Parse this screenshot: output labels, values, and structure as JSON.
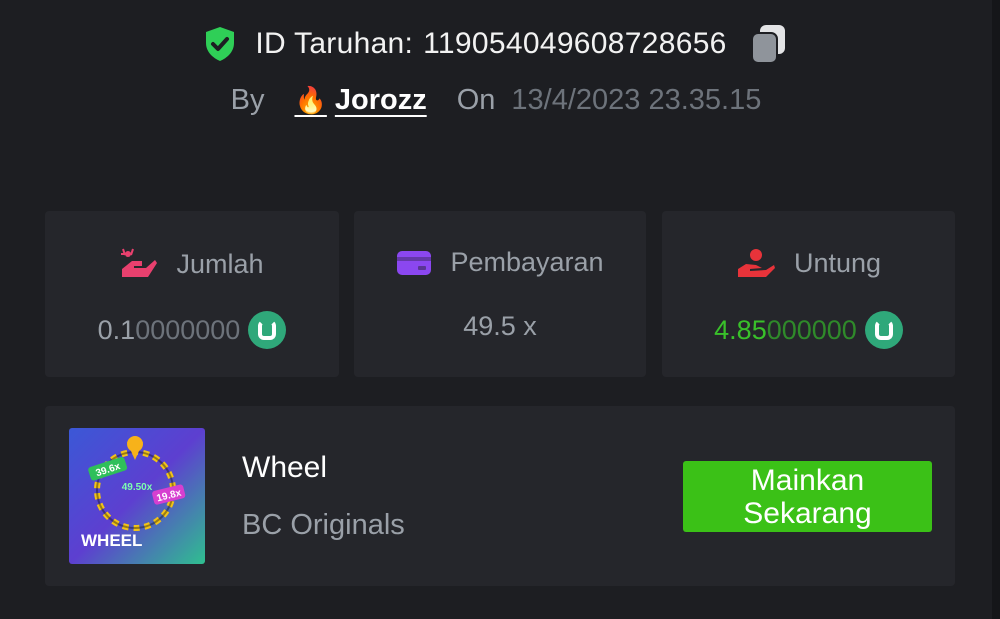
{
  "bet": {
    "id_label": "ID Taruhan:",
    "id_value": "119054049608728656",
    "by_label": "By",
    "username": "Jorozz",
    "on_label": "On",
    "date": "13/4/2023 23.35.15"
  },
  "stats": [
    {
      "label": "Jumlah",
      "value_main": "0.1",
      "value_dim": "0000000",
      "value_color": "#9aa0a8",
      "icon": "hand-coins-icon",
      "icon_color": "#e8406e"
    },
    {
      "label": "Pembayaran",
      "value": "49.5 x",
      "value_color": "#9aa0a8",
      "icon": "wallet-card-icon",
      "icon_color": "#8b47f0"
    },
    {
      "label": "Untung",
      "value_main": "4.85",
      "value_dim": "000000",
      "value_color": "#39c12a",
      "icon": "profit-hand-icon",
      "icon_color": "#e8333a"
    }
  ],
  "game": {
    "thumb_text": "WHEEL",
    "thumb_multipliers": [
      "39.6x",
      "49.50x",
      "19.8x"
    ],
    "title": "Wheel",
    "provider": "BC Originals",
    "play_label": "Mainkan Sekarang"
  },
  "colors": {
    "background": "#1d1e22",
    "card": "#25262b",
    "accent_green": "#3bc117",
    "coin": "#2fa87a",
    "shield": "#2fcf57"
  }
}
